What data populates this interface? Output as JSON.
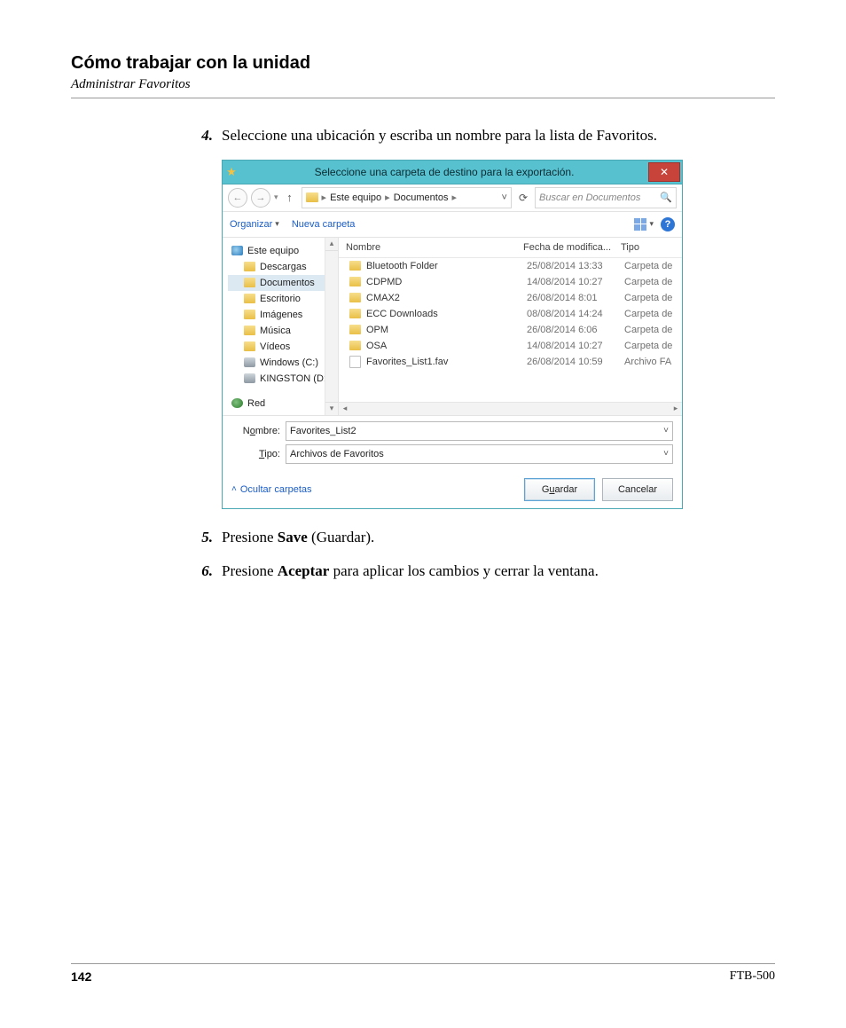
{
  "doc": {
    "heading": "Cómo trabajar con la unidad",
    "subheading": "Administrar Favoritos",
    "page_number": "142",
    "model": "FTB-500"
  },
  "steps": {
    "s4_num": "4.",
    "s4_text": "Seleccione una ubicación y escriba un nombre para la lista de Favoritos.",
    "s5_num": "5.",
    "s5_pre": "Presione ",
    "s5_bold": "Save",
    "s5_post": " (Guardar).",
    "s6_num": "6.",
    "s6_pre": "Presione ",
    "s6_bold": "Aceptar",
    "s6_post": " para aplicar los cambios y cerrar la ventana."
  },
  "dialog": {
    "title": "Seleccione una carpeta de destino para la exportación.",
    "breadcrumb": {
      "p1": "Este equipo",
      "p2": "Documentos"
    },
    "search_placeholder": "Buscar en Documentos",
    "toolbar": {
      "organize": "Organizar",
      "newfolder": "Nueva carpeta"
    },
    "tree": {
      "n0": "Este equipo",
      "n1": "Descargas",
      "n2": "Documentos",
      "n3": "Escritorio",
      "n4": "Imágenes",
      "n5": "Música",
      "n6": "Vídeos",
      "n7": "Windows (C:)",
      "n8": "KINGSTON (D:)",
      "n9": "Red"
    },
    "columns": {
      "name": "Nombre",
      "date": "Fecha de modifica...",
      "type": "Tipo"
    },
    "rows": [
      {
        "name": "Bluetooth Folder",
        "date": "25/08/2014 13:33",
        "type": "Carpeta de",
        "icon": "folder"
      },
      {
        "name": "CDPMD",
        "date": "14/08/2014 10:27",
        "type": "Carpeta de",
        "icon": "folder"
      },
      {
        "name": "CMAX2",
        "date": "26/08/2014 8:01",
        "type": "Carpeta de",
        "icon": "folder"
      },
      {
        "name": "ECC Downloads",
        "date": "08/08/2014 14:24",
        "type": "Carpeta de",
        "icon": "folder"
      },
      {
        "name": "OPM",
        "date": "26/08/2014 6:06",
        "type": "Carpeta de",
        "icon": "folder"
      },
      {
        "name": "OSA",
        "date": "14/08/2014 10:27",
        "type": "Carpeta de",
        "icon": "folder"
      },
      {
        "name": "Favorites_List1.fav",
        "date": "26/08/2014 10:59",
        "type": "Archivo FA",
        "icon": "file"
      }
    ],
    "fields": {
      "name_label_pre": "N",
      "name_label_ul": "o",
      "name_label_post": "mbre:",
      "name_value": "Favorites_List2",
      "type_label_pre": "",
      "type_label_ul": "T",
      "type_label_post": "ipo:",
      "type_value": "Archivos de Favoritos"
    },
    "bottom": {
      "hide": "Ocultar carpetas",
      "save_pre": "G",
      "save_ul": "u",
      "save_post": "ardar",
      "cancel": "Cancelar"
    }
  }
}
